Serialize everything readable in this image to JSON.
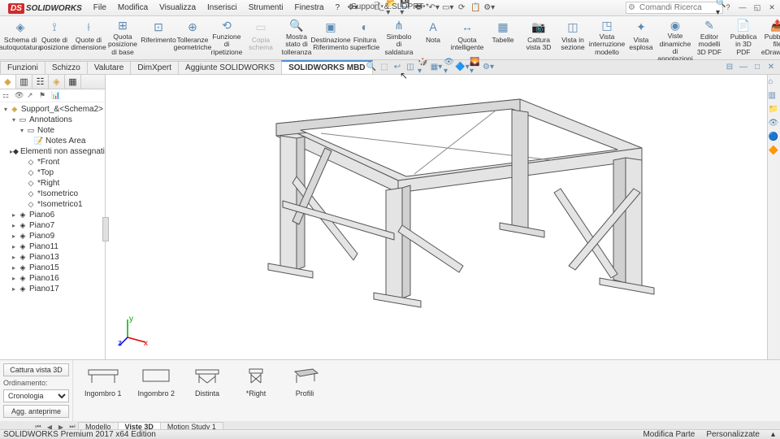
{
  "app": {
    "brand": "SOLIDWORKS",
    "doc_title": "Support_&.SLDPRT *"
  },
  "menu": [
    "File",
    "Modifica",
    "Visualizza",
    "Inserisci",
    "Strumenti",
    "Finestra",
    "?"
  ],
  "search": {
    "placeholder": "Comandi Ricerca"
  },
  "ribbon": [
    {
      "ico": "◈",
      "lbl": "Schema di autoquotatura"
    },
    {
      "ico": "⟟",
      "lbl": "Quote di posizione"
    },
    {
      "ico": "⟊",
      "lbl": "Quote di dimensione"
    },
    {
      "ico": "⊞",
      "lbl": "Quota posizione di base"
    },
    {
      "ico": "⊡",
      "lbl": "Riferimento"
    },
    {
      "ico": "⊕",
      "lbl": "Tolleranze geometriche"
    },
    {
      "ico": "⟲",
      "lbl": "Funzione di ripetizione"
    },
    {
      "ico": "▭",
      "lbl": "Copia schema",
      "disabled": true
    },
    {
      "ico": "🔍",
      "lbl": "Mostra stato di tolleranza"
    },
    {
      "ico": "▣",
      "lbl": "Destinazione Riferimento"
    },
    {
      "ico": "◐",
      "lbl": "Finitura superficie"
    },
    {
      "ico": "⋔",
      "lbl": "Simbolo di saldatura"
    },
    {
      "ico": "A",
      "lbl": "Nota"
    },
    {
      "ico": "↔",
      "lbl": "Quota intelligente"
    },
    {
      "ico": "▦",
      "lbl": "Tabelle"
    },
    {
      "ico": "📷",
      "lbl": "Cattura vista 3D"
    },
    {
      "ico": "◫",
      "lbl": "Vista in sezione"
    },
    {
      "ico": "◳",
      "lbl": "Vista interruzione modello"
    },
    {
      "ico": "✦",
      "lbl": "Vista esplosa"
    },
    {
      "ico": "◉",
      "lbl": "Viste dinamiche di annotazioni"
    },
    {
      "ico": "✎",
      "lbl": "Editor modelli 3D PDF"
    },
    {
      "ico": "📄",
      "lbl": "Pubblica in 3D PDF"
    },
    {
      "ico": "📤",
      "lbl": "Pubblica file eDrawings"
    }
  ],
  "tabs": [
    "Funzioni",
    "Schizzo",
    "Valutare",
    "DimXpert",
    "Aggiunte SOLIDWORKS",
    "SOLIDWORKS MBD"
  ],
  "active_tab": 5,
  "tree": {
    "root": "Support_&<Schema2>",
    "nodes": [
      {
        "exp": "▾",
        "ico": "▭",
        "lbl": "Annotations",
        "ind": 1
      },
      {
        "exp": "▾",
        "ico": "▭",
        "lbl": "Note",
        "ind": 2
      },
      {
        "exp": "",
        "ico": "📝",
        "lbl": "Notes Area",
        "ind": 3
      },
      {
        "exp": "▸",
        "ico": "◆",
        "lbl": "Elementi non assegnati",
        "ind": 1
      },
      {
        "exp": "",
        "ico": "◇",
        "lbl": "*Front",
        "ind": 2
      },
      {
        "exp": "",
        "ico": "◇",
        "lbl": "*Top",
        "ind": 2
      },
      {
        "exp": "",
        "ico": "◇",
        "lbl": "*Right",
        "ind": 2
      },
      {
        "exp": "",
        "ico": "◇",
        "lbl": "*Isometrico",
        "ind": 2
      },
      {
        "exp": "",
        "ico": "◇",
        "lbl": "*Isometrico1",
        "ind": 2
      },
      {
        "exp": "▸",
        "ico": "◈",
        "lbl": "Piano6",
        "ind": 1
      },
      {
        "exp": "▸",
        "ico": "◈",
        "lbl": "Piano7",
        "ind": 1
      },
      {
        "exp": "▸",
        "ico": "◈",
        "lbl": "Piano9",
        "ind": 1
      },
      {
        "exp": "▸",
        "ico": "◈",
        "lbl": "Piano11",
        "ind": 1
      },
      {
        "exp": "▸",
        "ico": "◈",
        "lbl": "Piano13",
        "ind": 1
      },
      {
        "exp": "▸",
        "ico": "◈",
        "lbl": "Piano15",
        "ind": 1
      },
      {
        "exp": "▸",
        "ico": "◈",
        "lbl": "Piano16",
        "ind": 1
      },
      {
        "exp": "▸",
        "ico": "◈",
        "lbl": "Piano17",
        "ind": 1
      }
    ]
  },
  "bottom": {
    "capture": "Cattura vista 3D",
    "sort_lbl": "Ordinamento:",
    "sort_val": "Cronologia",
    "update": "Agg. anteprime",
    "views": [
      "Ingombro 1",
      "Ingombro 2",
      "Distinta",
      "*Right",
      "Profili"
    ]
  },
  "bottom_tabs": [
    "Modello",
    "Viste 3D",
    "Motion Study 1"
  ],
  "active_bottom_tab": 1,
  "status": {
    "left": "SOLIDWORKS Premium 2017 x64 Edition",
    "mode": "Modifica Parte",
    "custom": "Personalizzate"
  },
  "triad": {
    "x": "x",
    "y": "y",
    "z": "z"
  }
}
